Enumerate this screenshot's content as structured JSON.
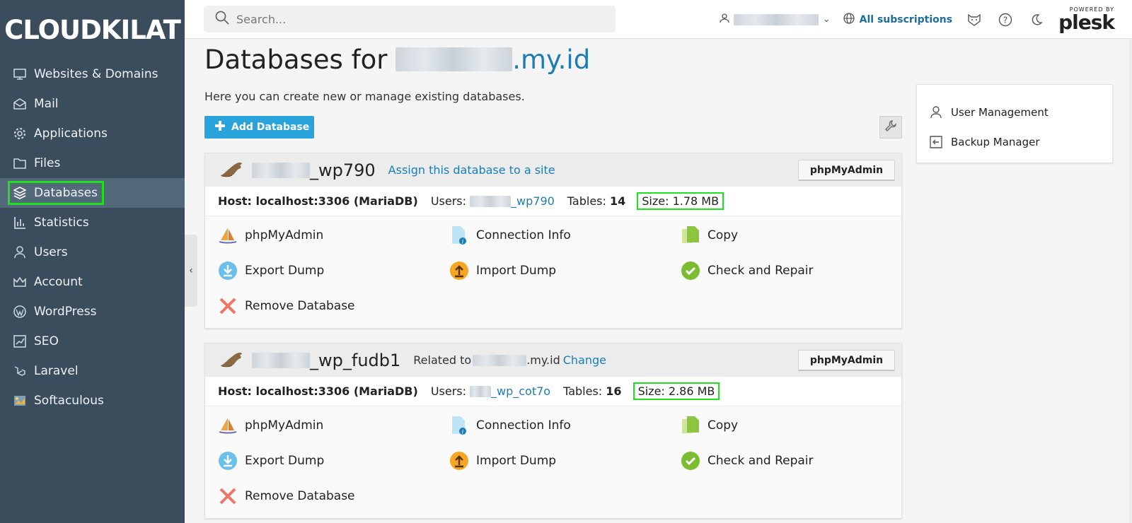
{
  "sidebar": {
    "logo": "CLOUDKILAT",
    "items": [
      {
        "label": "Websites & Domains",
        "icon": "monitor-icon"
      },
      {
        "label": "Mail",
        "icon": "envelope-icon"
      },
      {
        "label": "Applications",
        "icon": "gear-icon"
      },
      {
        "label": "Files",
        "icon": "folder-icon"
      },
      {
        "label": "Databases",
        "icon": "database-icon",
        "active": true
      },
      {
        "label": "Statistics",
        "icon": "bar-chart-icon"
      },
      {
        "label": "Users",
        "icon": "user-icon"
      },
      {
        "label": "Account",
        "icon": "crown-icon"
      },
      {
        "label": "WordPress",
        "icon": "wordpress-icon"
      },
      {
        "label": "SEO",
        "icon": "seo-chart-icon"
      },
      {
        "label": "Laravel",
        "icon": "laravel-icon"
      },
      {
        "label": "Softaculous",
        "icon": "softaculous-icon"
      }
    ]
  },
  "header": {
    "search_placeholder": "Search...",
    "subscriptions_label": "All subscriptions",
    "plesk_powered": "POWERED BY",
    "plesk_name": "plesk"
  },
  "page": {
    "title_prefix": "Databases for ",
    "title_domain_suffix": ".my.id",
    "intro": "Here you can create new or manage existing databases.",
    "add_button": "Add Database"
  },
  "databases": [
    {
      "name_suffix": "_wp790",
      "link_text": "Assign this database to a site",
      "pma_button": "phpMyAdmin",
      "host_label": "Host: localhost:3306 (MariaDB)",
      "users_label": "Users:",
      "user_suffix": "_wp790",
      "tables_label": "Tables:",
      "tables_value": "14",
      "size_label": "Size: 1.78 MB"
    },
    {
      "name_suffix": "_wp_fudb1",
      "related_label": "Related to",
      "related_suffix": ".my.id",
      "change_label": "Change",
      "pma_button": "phpMyAdmin",
      "host_label": "Host: localhost:3306 (MariaDB)",
      "users_label": "Users:",
      "user_suffix": "_wp_cot7o",
      "tables_label": "Tables:",
      "tables_value": "16",
      "size_label": "Size: 2.86 MB"
    }
  ],
  "actions": {
    "phpmyadmin": "phpMyAdmin",
    "connection_info": "Connection Info",
    "copy": "Copy",
    "export_dump": "Export Dump",
    "import_dump": "Import Dump",
    "check_repair": "Check and Repair",
    "remove": "Remove Database"
  },
  "side_panel": {
    "user_management": "User Management",
    "backup_manager": "Backup Manager"
  },
  "colors": {
    "sidebar": "#3b4d5c",
    "sidebar_active": "#53697a",
    "link": "#1c7db5",
    "primary_button": "#28a3dc",
    "highlight": "#1ee01e"
  }
}
